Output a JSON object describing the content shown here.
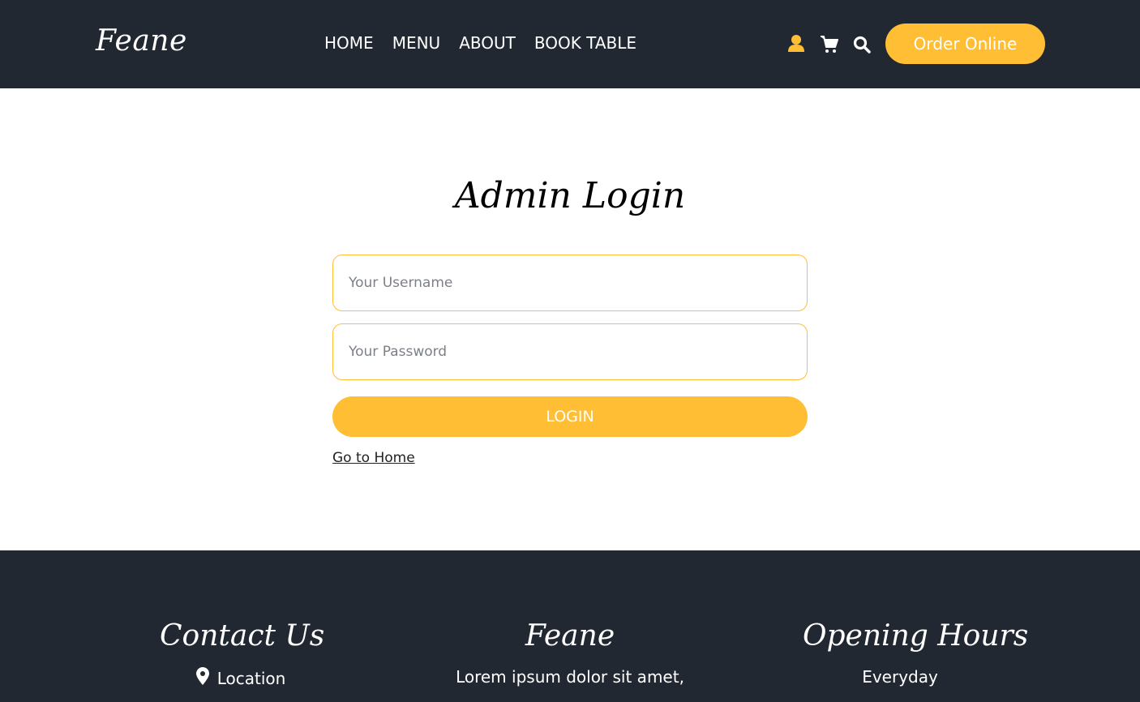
{
  "header": {
    "brand": "Feane",
    "nav": [
      "HOME",
      "MENU",
      "ABOUT",
      "BOOK TABLE"
    ],
    "icons": [
      "user-icon",
      "cart-icon",
      "search-icon"
    ],
    "order_button": "Order Online"
  },
  "login": {
    "title": "Admin Login",
    "username_placeholder": "Your Username",
    "password_placeholder": "Your Password",
    "login_button": "LOGIN",
    "home_link": "Go to Home"
  },
  "footer": {
    "contact": {
      "heading": "Contact Us",
      "location": "Location"
    },
    "about": {
      "heading": "Feane",
      "text": "Lorem ipsum dolor sit amet,"
    },
    "hours": {
      "heading": "Opening Hours",
      "text": "Everyday"
    }
  },
  "colors": {
    "dark": "#222831",
    "accent": "#ffbe33"
  }
}
